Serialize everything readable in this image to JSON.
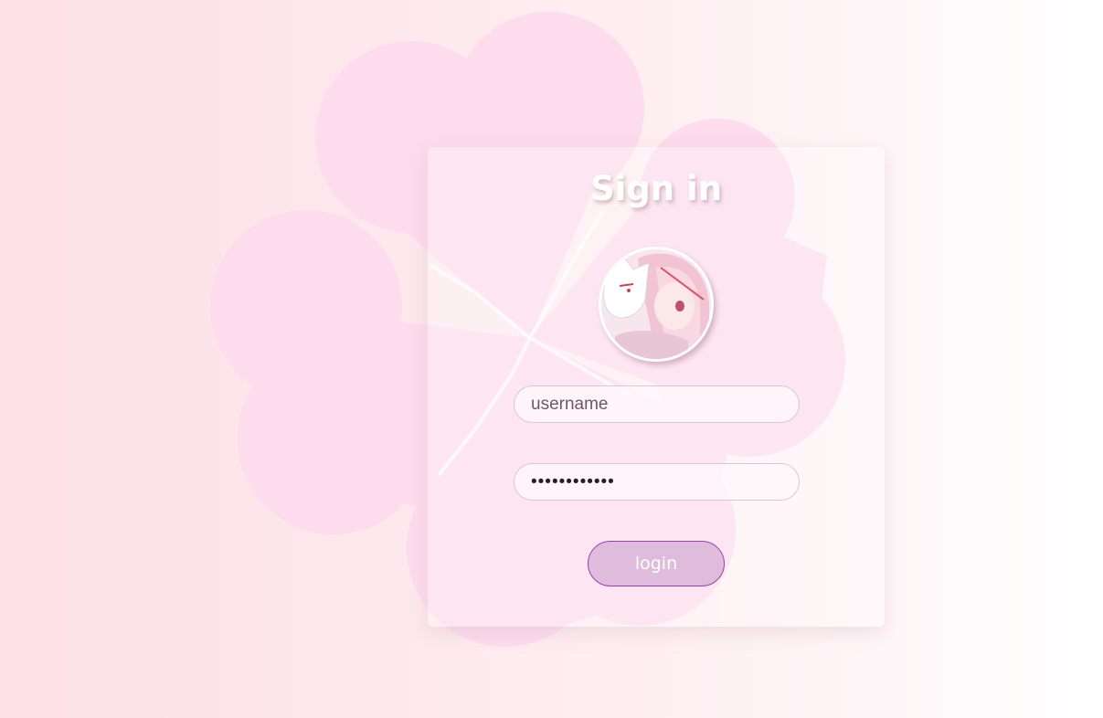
{
  "login": {
    "title": "Sign in",
    "username_placeholder": "username",
    "password_value": "••••••••••••",
    "login_button_label": "login"
  },
  "colors": {
    "blossom": "#fddcee",
    "button_fill": "#dfbcdc",
    "button_border": "#9b3fb0"
  }
}
